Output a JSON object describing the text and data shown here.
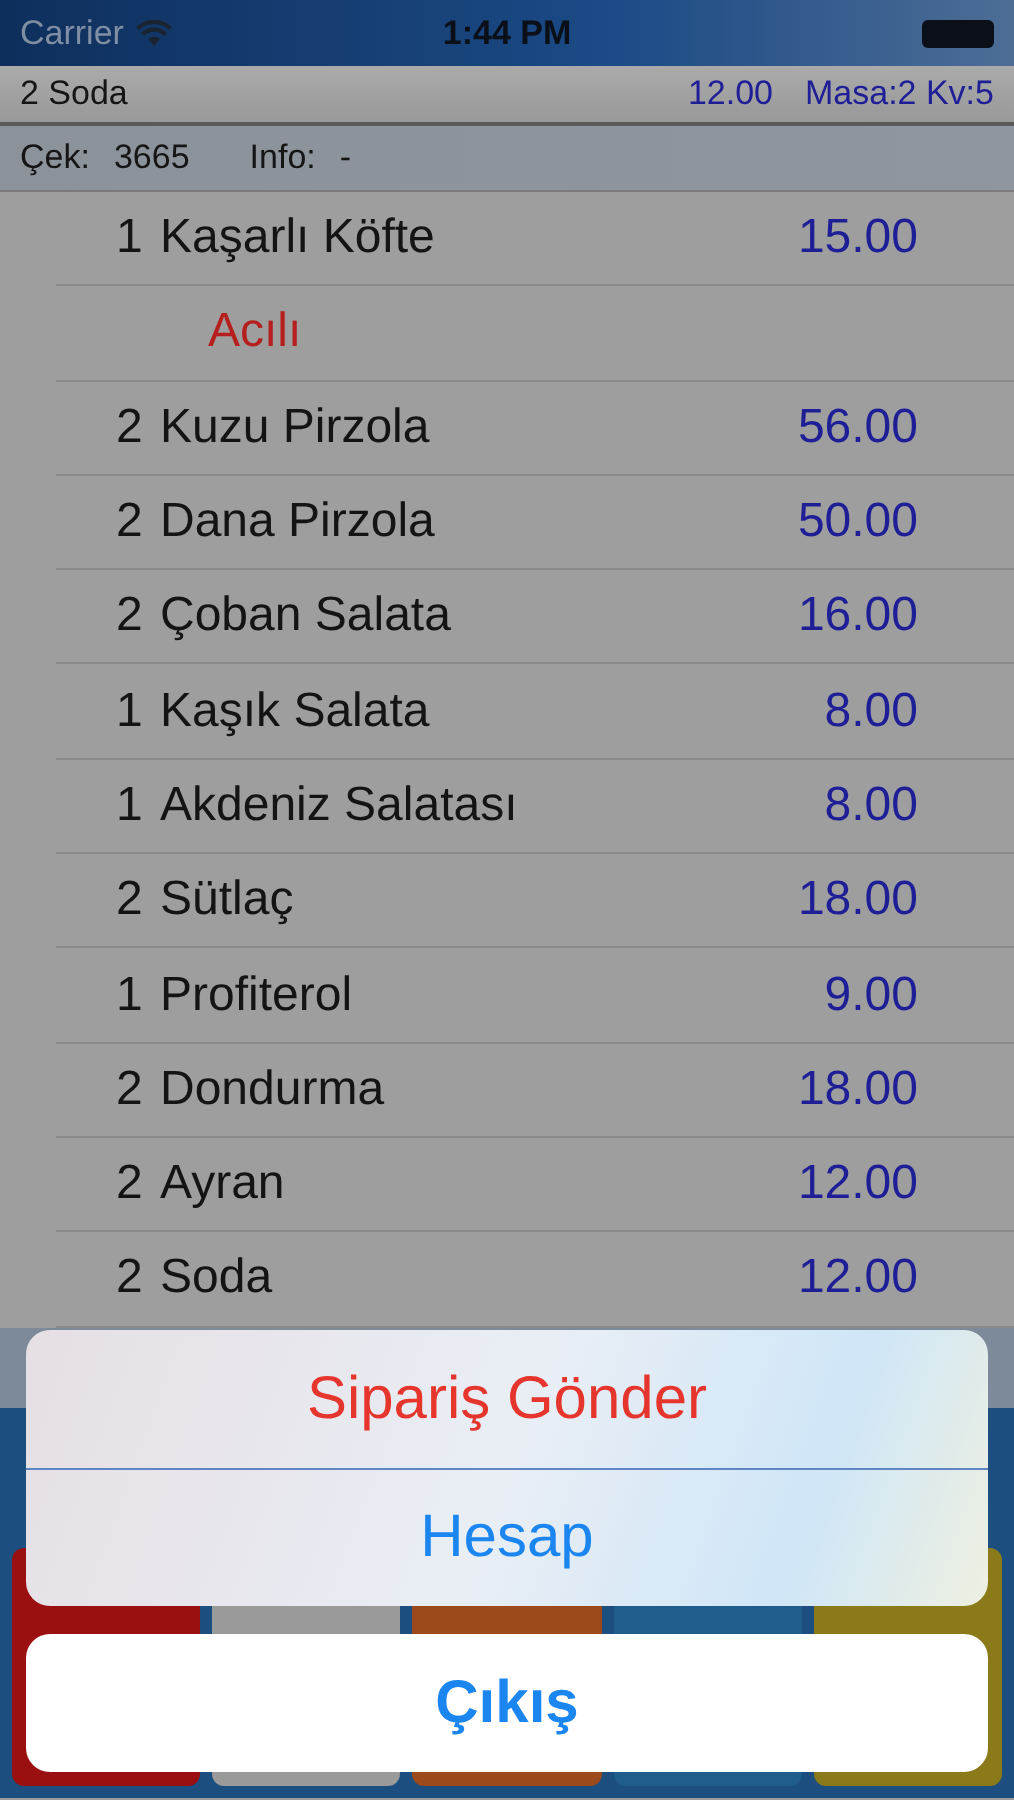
{
  "status_bar": {
    "carrier": "Carrier",
    "time": "1:44 PM"
  },
  "header": {
    "last_item": "2 Soda",
    "last_price": "12.00",
    "table_info": "Masa:2 Kv:5"
  },
  "check_bar": {
    "check_label": "Çek:",
    "check_number": "3665",
    "info_label": "Info:",
    "info_value": "-"
  },
  "order_items": [
    {
      "kind": "item",
      "qty": "1",
      "name": "Kaşarlı Köfte",
      "price": "15.00"
    },
    {
      "kind": "note",
      "name": "Acılı"
    },
    {
      "kind": "item",
      "qty": "2",
      "name": "Kuzu Pirzola",
      "price": "56.00"
    },
    {
      "kind": "item",
      "qty": "2",
      "name": "Dana Pirzola",
      "price": "50.00"
    },
    {
      "kind": "item",
      "qty": "2",
      "name": "Çoban Salata",
      "price": "16.00"
    },
    {
      "kind": "item",
      "qty": "1",
      "name": "Kaşık Salata",
      "price": "8.00"
    },
    {
      "kind": "item",
      "qty": "1",
      "name": "Akdeniz Salatası",
      "price": "8.00"
    },
    {
      "kind": "item",
      "qty": "2",
      "name": "Sütlaç",
      "price": "18.00"
    },
    {
      "kind": "item",
      "qty": "1",
      "name": "Profiterol",
      "price": "9.00"
    },
    {
      "kind": "item",
      "qty": "2",
      "name": "Dondurma",
      "price": "18.00"
    },
    {
      "kind": "item",
      "qty": "2",
      "name": "Ayran",
      "price": "12.00"
    },
    {
      "kind": "item",
      "qty": "2",
      "name": "Soda",
      "price": "12.00"
    }
  ],
  "action_sheet": {
    "actions": [
      {
        "label": "Sipariş Gönder",
        "kind": "destructive"
      },
      {
        "label": "Hesap",
        "kind": "default"
      }
    ],
    "cancel": "Çıkış"
  }
}
